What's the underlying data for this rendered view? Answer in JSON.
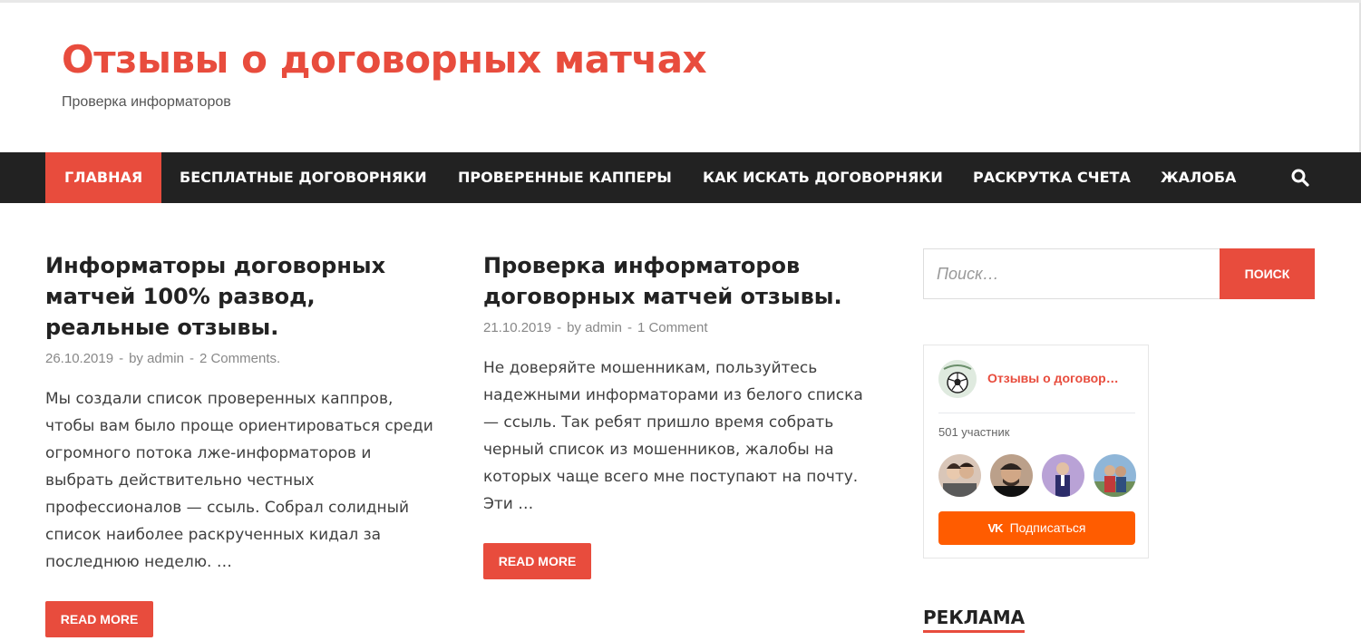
{
  "site": {
    "title": "Отзывы о договорных матчах",
    "tagline": "Проверка информаторов"
  },
  "nav": {
    "items": [
      {
        "label": "ГЛАВНАЯ",
        "active": true
      },
      {
        "label": "БЕСПЛАТНЫЕ ДОГОВОРНЯКИ"
      },
      {
        "label": "ПРОВЕРЕННЫЕ КАППЕРЫ"
      },
      {
        "label": "КАК ИСКАТЬ ДОГОВОРНЯКИ"
      },
      {
        "label": "РАСКРУТКА СЧЕТА"
      },
      {
        "label": "ЖАЛОБА"
      }
    ],
    "search_icon": "search-icon"
  },
  "posts": [
    {
      "title": "Информаторы договорных матчей 100% развод, реальные отзывы.",
      "date": "26.10.2019",
      "author": "by admin",
      "comments": "2 Comments.",
      "excerpt": "Мы создали список проверенных каппров, чтобы вам было проще ориентироваться среди огромного потока лже-информаторов и выбрать действительно честных профессионалов — ссыль. Собрал солидный список наиболее раскрученных кидал за последнюю неделю. …",
      "read_more": "READ MORE"
    },
    {
      "title": "Проверка информаторов договорных матчей отзывы.",
      "date": "21.10.2019",
      "author": "by admin",
      "comments": "1 Comment",
      "excerpt": "Не доверяйте мошенникам, пользуйтесь надежными информаторами из белого списка — ссыль. Так ребят пришло время собрать черный список из мошенников, жалобы на которых чаще всего мне поступают на почту. Эти …",
      "read_more": "READ MORE"
    }
  ],
  "sidebar": {
    "search": {
      "placeholder": "Поиск…",
      "button": "ПОИСК"
    },
    "vk_widget": {
      "group_name": "Отзывы о договор…",
      "members": "501 участник",
      "subscribe": "Подписаться",
      "vk_mark": "VK"
    },
    "ad_heading": "РЕКЛАМА"
  },
  "separator": "-",
  "colors": {
    "accent": "#e84c3d",
    "navbar": "#222222",
    "vk_button": "#ff5c00"
  }
}
